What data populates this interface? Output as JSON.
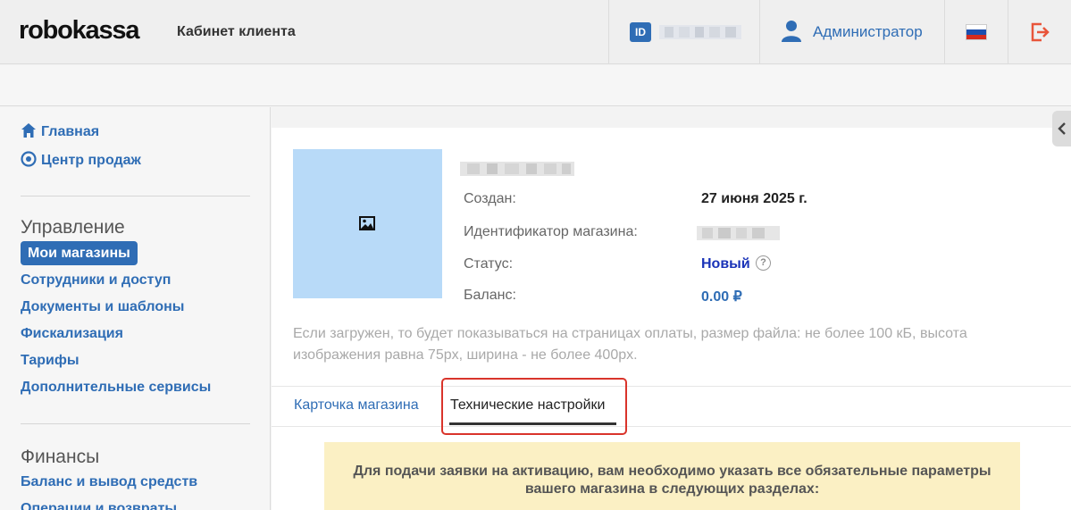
{
  "header": {
    "logo": "robokassa",
    "cabinet_label": "Кабинет клиента",
    "id_badge": "ID",
    "user_name": "Администратор",
    "colors": {
      "accent": "#2f6db5",
      "logout": "#e8553a"
    }
  },
  "sidebar": {
    "top_links": [
      {
        "label": "Главная",
        "icon": "home-icon"
      },
      {
        "label": "Центр продаж",
        "icon": "target-icon"
      }
    ],
    "management": {
      "title": "Управление",
      "items": [
        "Мои магазины",
        "Сотрудники и доступ",
        "Документы и шаблоны",
        "Фискализация",
        "Тарифы",
        "Дополнительные сервисы"
      ],
      "active_index": 0
    },
    "finance": {
      "title": "Финансы",
      "items": [
        "Баланс и вывод средств",
        "Операции и возвраты"
      ]
    }
  },
  "shop": {
    "created_label": "Создан:",
    "created_value": "27 июня 2025 г.",
    "shop_id_label": "Идентификатор магазина:",
    "status_label": "Статус:",
    "status_value": "Новый",
    "balance_label": "Баланс:",
    "balance_value": "0.00 ₽",
    "upload_note": "Если загружен, то будет показываться на страницах оплаты, размер файла: не более 100 кБ, высота изображения равна 75px, ширина - не более 400px."
  },
  "tabs": [
    {
      "label": "Карточка магазина",
      "active": false
    },
    {
      "label": "Технические настройки",
      "active": true
    }
  ],
  "notice": {
    "line1": "Для подачи заявки на активацию, вам необходимо указать все обязательные параметры",
    "line2": "вашего магазина в следующих разделах:"
  }
}
